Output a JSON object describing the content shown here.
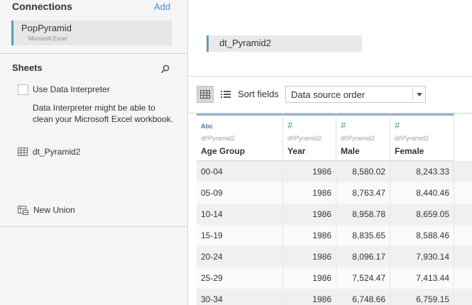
{
  "connections": {
    "title": "Connections",
    "add_label": "Add",
    "items": [
      {
        "name": "PopPyramid",
        "type": "Microsoft Excel"
      }
    ]
  },
  "sheets": {
    "title": "Sheets",
    "interpreter_label": "Use Data Interpreter",
    "interpreter_help": "Data Interpreter might be able to clean your Microsoft Excel workbook.",
    "items": [
      {
        "name": "dt_Pyramid2"
      }
    ],
    "new_union_label": "New Union"
  },
  "canvas": {
    "table_name": "dt_Pyramid2"
  },
  "toolbar": {
    "sort_label": "Sort fields",
    "sort_value": "Data source order"
  },
  "grid": {
    "columns": [
      {
        "type": "Abc",
        "source": "dt!Pyramid2",
        "name": "Age Group"
      },
      {
        "type": "#",
        "source": "dt!Pyramid2",
        "name": "Year"
      },
      {
        "type": "#",
        "source": "dt!Pyramid2",
        "name": "Male"
      },
      {
        "type": "#",
        "source": "dt!Pyramid2",
        "name": "Female"
      }
    ],
    "rows": [
      [
        "00-04",
        "1986",
        "8,580.02",
        "8,243.33"
      ],
      [
        "05-09",
        "1986",
        "8,763.47",
        "8,440.46"
      ],
      [
        "10-14",
        "1986",
        "8,958.78",
        "8,659.05"
      ],
      [
        "15-19",
        "1986",
        "8,835.65",
        "8,588.46"
      ],
      [
        "20-24",
        "1986",
        "8,096.17",
        "7,930.14"
      ],
      [
        "25-29",
        "1986",
        "7,524.47",
        "7,413.44"
      ],
      [
        "30-34",
        "1986",
        "6,748.66",
        "6,759.15"
      ]
    ]
  },
  "colors": {
    "accent": "#5b9bb8",
    "link": "#4f8bc9",
    "number_type": "#4aa07a",
    "string_type": "#4d7aa6"
  }
}
